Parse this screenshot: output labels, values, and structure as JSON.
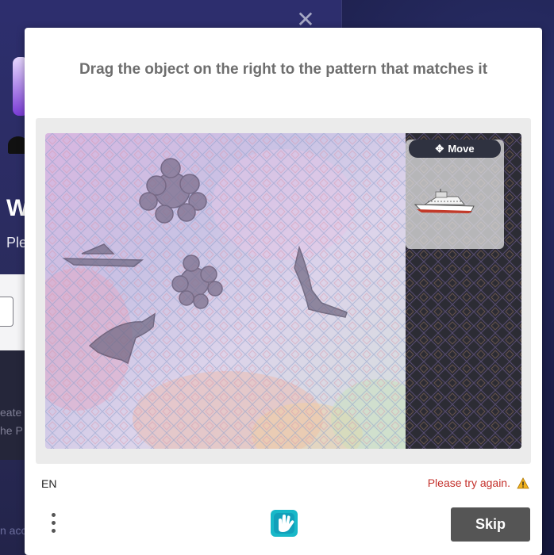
{
  "background": {
    "heading_fragment": "W",
    "sub_fragment": "Ple",
    "faint_line_1": "eate",
    "faint_line_2": "he P",
    "bottom_fragment": "n acc"
  },
  "challenge": {
    "prompt": "Drag the object on the right to the pattern that matches it",
    "move_label": "Move",
    "language": "EN",
    "error_message": "Please try again.",
    "skip_label": "Skip"
  },
  "icons": {
    "close": "close-icon",
    "move": "move-arrows-icon",
    "warning": "warning-icon",
    "menu": "more-vertical-icon",
    "logo": "hand-logo-icon",
    "draggable": "ship-icon"
  },
  "colors": {
    "error": "#c4302b",
    "skip_button": "#555555",
    "move_badge": "#2f3240",
    "logo_teal": "#18b8c8"
  }
}
